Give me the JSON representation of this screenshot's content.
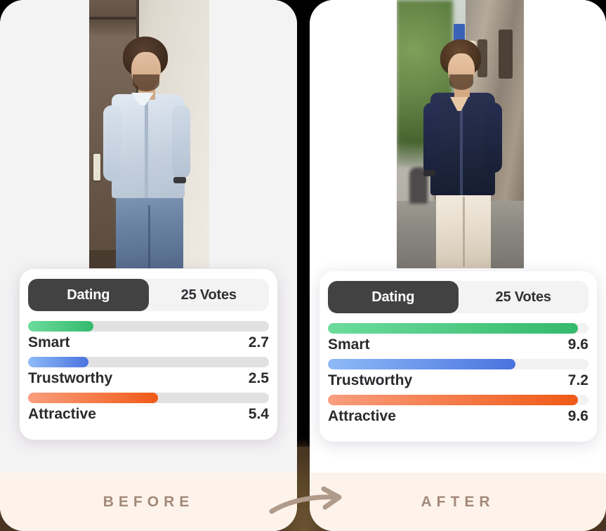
{
  "comparison": {
    "colors": {
      "background": "#000000",
      "footer_bg": "#fdf3ea",
      "footer_text": "#a4897a",
      "toggle_active_bg": "#434243",
      "track": "#e1e1e1",
      "green": "#34b96d",
      "blue": "#4a74de",
      "orange": "#f05a17",
      "brown_plume": "#4a3522"
    },
    "arrow_icon": "curved-right-arrow-icon",
    "panels": [
      {
        "id": "before",
        "caption": "BEFORE",
        "photo_alt": "man in light blue linen shirt and jeans leaning on doorway",
        "toggle": {
          "active_label": "Dating",
          "votes_label": "25 Votes"
        },
        "metrics": [
          {
            "label": "Smart",
            "value": "2.7",
            "percent": 27,
            "color": "green"
          },
          {
            "label": "Trustworthy",
            "value": "2.5",
            "percent": 25,
            "color": "blue"
          },
          {
            "label": "Attractive",
            "value": "5.4",
            "percent": 54,
            "color": "orange"
          }
        ]
      },
      {
        "id": "after",
        "caption": "AFTER",
        "photo_alt": "man in navy shirt and cream trousers walking on a street",
        "toggle": {
          "active_label": "Dating",
          "votes_label": "25 Votes"
        },
        "metrics": [
          {
            "label": "Smart",
            "value": "9.6",
            "percent": 96,
            "color": "green"
          },
          {
            "label": "Trustworthy",
            "value": "7.2",
            "percent": 72,
            "color": "blue"
          },
          {
            "label": "Attractive",
            "value": "9.6",
            "percent": 96,
            "color": "orange"
          }
        ]
      }
    ]
  }
}
